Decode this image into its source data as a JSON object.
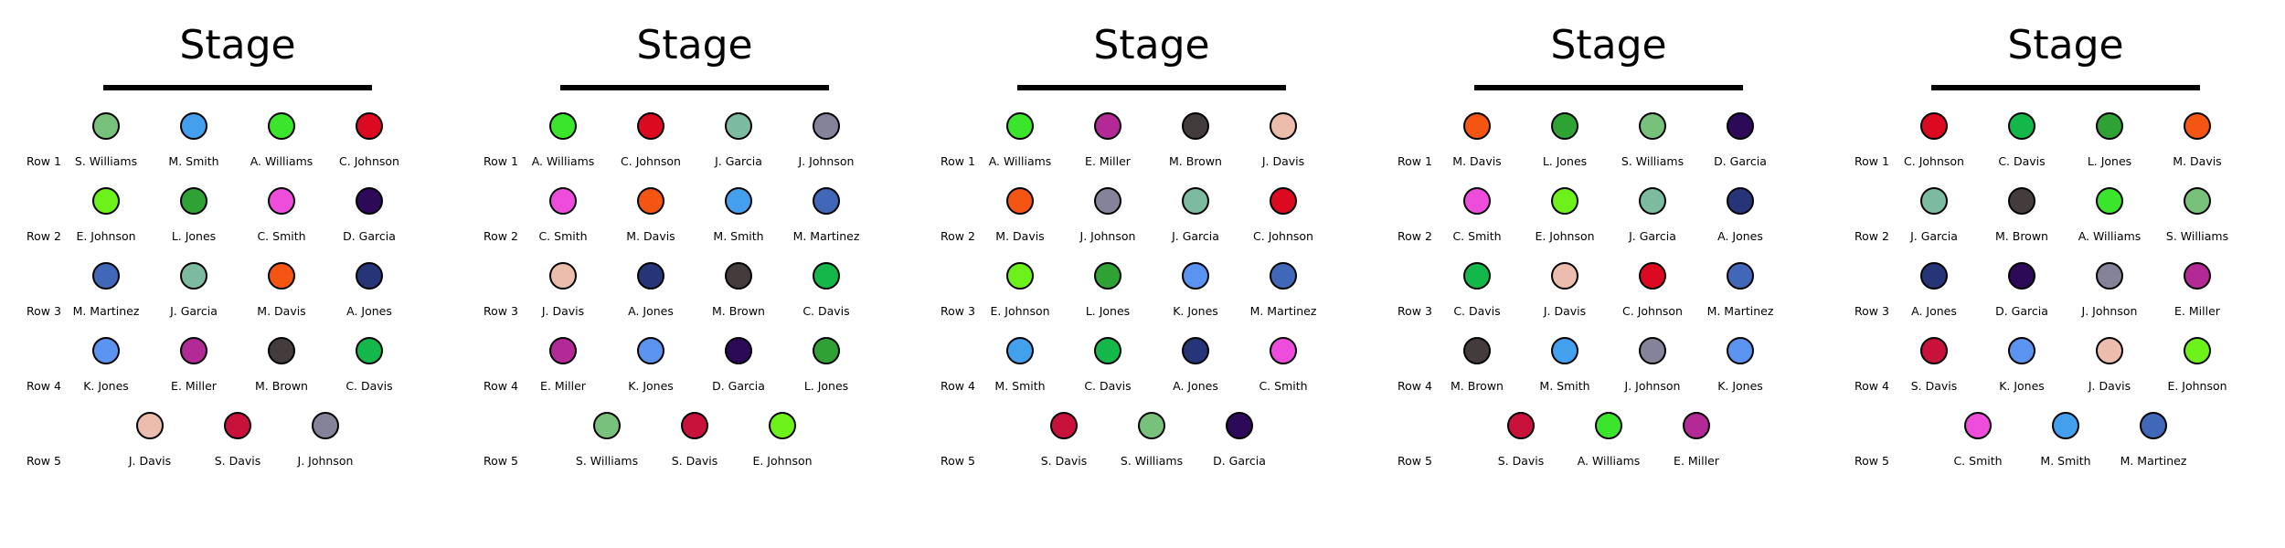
{
  "stage_label": "Stage",
  "panels": [
    {
      "rows": [
        {
          "label": "Row 1",
          "seats": [
            {
              "name": "S. Williams",
              "color": "#78c17b"
            },
            {
              "name": "M. Smith",
              "color": "#42a0ee"
            },
            {
              "name": "A. Williams",
              "color": "#3ae52c"
            },
            {
              "name": "C. Johnson",
              "color": "#dc0a20"
            }
          ]
        },
        {
          "label": "Row 2",
          "seats": [
            {
              "name": "E. Johnson",
              "color": "#6cf21a"
            },
            {
              "name": "L. Jones",
              "color": "#2fa235"
            },
            {
              "name": "C. Smith",
              "color": "#ee4ddb"
            },
            {
              "name": "D. Garcia",
              "color": "#2c0a58"
            }
          ]
        },
        {
          "label": "Row 3",
          "seats": [
            {
              "name": "M. Martinez",
              "color": "#4168b8"
            },
            {
              "name": "J. Garcia",
              "color": "#7dbba0"
            },
            {
              "name": "M. Davis",
              "color": "#f45512"
            },
            {
              "name": "A. Jones",
              "color": "#263478"
            }
          ]
        },
        {
          "label": "Row 4",
          "seats": [
            {
              "name": "K. Jones",
              "color": "#5b94f0"
            },
            {
              "name": "E. Miller",
              "color": "#b32996"
            },
            {
              "name": "M. Brown",
              "color": "#443c3c"
            },
            {
              "name": "C. Davis",
              "color": "#14b84a"
            }
          ]
        },
        {
          "label": "Row 5",
          "seats": [
            {
              "name": "J. Davis",
              "color": "#ecbcac"
            },
            {
              "name": "S. Davis",
              "color": "#c8123c"
            },
            {
              "name": "J. Johnson",
              "color": "#85839a"
            }
          ]
        }
      ]
    },
    {
      "rows": [
        {
          "label": "Row 1",
          "seats": [
            {
              "name": "A. Williams",
              "color": "#3ae52c"
            },
            {
              "name": "C. Johnson",
              "color": "#dc0a20"
            },
            {
              "name": "J. Garcia",
              "color": "#7dbba0"
            },
            {
              "name": "J. Johnson",
              "color": "#85839a"
            }
          ]
        },
        {
          "label": "Row 2",
          "seats": [
            {
              "name": "C. Smith",
              "color": "#ee4ddb"
            },
            {
              "name": "M. Davis",
              "color": "#f45512"
            },
            {
              "name": "M. Smith",
              "color": "#42a0ee"
            },
            {
              "name": "M. Martinez",
              "color": "#4168b8"
            }
          ]
        },
        {
          "label": "Row 3",
          "seats": [
            {
              "name": "J. Davis",
              "color": "#ecbcac"
            },
            {
              "name": "A. Jones",
              "color": "#263478"
            },
            {
              "name": "M. Brown",
              "color": "#443c3c"
            },
            {
              "name": "C. Davis",
              "color": "#14b84a"
            }
          ]
        },
        {
          "label": "Row 4",
          "seats": [
            {
              "name": "E. Miller",
              "color": "#b32996"
            },
            {
              "name": "K. Jones",
              "color": "#5b94f0"
            },
            {
              "name": "D. Garcia",
              "color": "#2c0a58"
            },
            {
              "name": "L. Jones",
              "color": "#2fa235"
            }
          ]
        },
        {
          "label": "Row 5",
          "seats": [
            {
              "name": "S. Williams",
              "color": "#78c17b"
            },
            {
              "name": "S. Davis",
              "color": "#c8123c"
            },
            {
              "name": "E. Johnson",
              "color": "#6cf21a"
            }
          ]
        }
      ]
    },
    {
      "rows": [
        {
          "label": "Row 1",
          "seats": [
            {
              "name": "A. Williams",
              "color": "#3ae52c"
            },
            {
              "name": "E. Miller",
              "color": "#b32996"
            },
            {
              "name": "M. Brown",
              "color": "#443c3c"
            },
            {
              "name": "J. Davis",
              "color": "#ecbcac"
            }
          ]
        },
        {
          "label": "Row 2",
          "seats": [
            {
              "name": "M. Davis",
              "color": "#f45512"
            },
            {
              "name": "J. Johnson",
              "color": "#85839a"
            },
            {
              "name": "J. Garcia",
              "color": "#7dbba0"
            },
            {
              "name": "C. Johnson",
              "color": "#dc0a20"
            }
          ]
        },
        {
          "label": "Row 3",
          "seats": [
            {
              "name": "E. Johnson",
              "color": "#6cf21a"
            },
            {
              "name": "L. Jones",
              "color": "#2fa235"
            },
            {
              "name": "K. Jones",
              "color": "#5b94f0"
            },
            {
              "name": "M. Martinez",
              "color": "#4168b8"
            }
          ]
        },
        {
          "label": "Row 4",
          "seats": [
            {
              "name": "M. Smith",
              "color": "#42a0ee"
            },
            {
              "name": "C. Davis",
              "color": "#14b84a"
            },
            {
              "name": "A. Jones",
              "color": "#263478"
            },
            {
              "name": "C. Smith",
              "color": "#ee4ddb"
            }
          ]
        },
        {
          "label": "Row 5",
          "seats": [
            {
              "name": "S. Davis",
              "color": "#c8123c"
            },
            {
              "name": "S. Williams",
              "color": "#78c17b"
            },
            {
              "name": "D. Garcia",
              "color": "#2c0a58"
            }
          ]
        }
      ]
    },
    {
      "rows": [
        {
          "label": "Row 1",
          "seats": [
            {
              "name": "M. Davis",
              "color": "#f45512"
            },
            {
              "name": "L. Jones",
              "color": "#2fa235"
            },
            {
              "name": "S. Williams",
              "color": "#78c17b"
            },
            {
              "name": "D. Garcia",
              "color": "#2c0a58"
            }
          ]
        },
        {
          "label": "Row 2",
          "seats": [
            {
              "name": "C. Smith",
              "color": "#ee4ddb"
            },
            {
              "name": "E. Johnson",
              "color": "#6cf21a"
            },
            {
              "name": "J. Garcia",
              "color": "#7dbba0"
            },
            {
              "name": "A. Jones",
              "color": "#263478"
            }
          ]
        },
        {
          "label": "Row 3",
          "seats": [
            {
              "name": "C. Davis",
              "color": "#14b84a"
            },
            {
              "name": "J. Davis",
              "color": "#ecbcac"
            },
            {
              "name": "C. Johnson",
              "color": "#dc0a20"
            },
            {
              "name": "M. Martinez",
              "color": "#4168b8"
            }
          ]
        },
        {
          "label": "Row 4",
          "seats": [
            {
              "name": "M. Brown",
              "color": "#443c3c"
            },
            {
              "name": "M. Smith",
              "color": "#42a0ee"
            },
            {
              "name": "J. Johnson",
              "color": "#85839a"
            },
            {
              "name": "K. Jones",
              "color": "#5b94f0"
            }
          ]
        },
        {
          "label": "Row 5",
          "seats": [
            {
              "name": "S. Davis",
              "color": "#c8123c"
            },
            {
              "name": "A. Williams",
              "color": "#3ae52c"
            },
            {
              "name": "E. Miller",
              "color": "#b32996"
            }
          ]
        }
      ]
    },
    {
      "rows": [
        {
          "label": "Row 1",
          "seats": [
            {
              "name": "C. Johnson",
              "color": "#dc0a20"
            },
            {
              "name": "C. Davis",
              "color": "#14b84a"
            },
            {
              "name": "L. Jones",
              "color": "#2fa235"
            },
            {
              "name": "M. Davis",
              "color": "#f45512"
            }
          ]
        },
        {
          "label": "Row 2",
          "seats": [
            {
              "name": "J. Garcia",
              "color": "#7dbba0"
            },
            {
              "name": "M. Brown",
              "color": "#443c3c"
            },
            {
              "name": "A. Williams",
              "color": "#3ae52c"
            },
            {
              "name": "S. Williams",
              "color": "#78c17b"
            }
          ]
        },
        {
          "label": "Row 3",
          "seats": [
            {
              "name": "A. Jones",
              "color": "#263478"
            },
            {
              "name": "D. Garcia",
              "color": "#2c0a58"
            },
            {
              "name": "J. Johnson",
              "color": "#85839a"
            },
            {
              "name": "E. Miller",
              "color": "#b32996"
            }
          ]
        },
        {
          "label": "Row 4",
          "seats": [
            {
              "name": "S. Davis",
              "color": "#c8123c"
            },
            {
              "name": "K. Jones",
              "color": "#5b94f0"
            },
            {
              "name": "J. Davis",
              "color": "#ecbcac"
            },
            {
              "name": "E. Johnson",
              "color": "#6cf21a"
            }
          ]
        },
        {
          "label": "Row 5",
          "seats": [
            {
              "name": "C. Smith",
              "color": "#ee4ddb"
            },
            {
              "name": "M. Smith",
              "color": "#42a0ee"
            },
            {
              "name": "M. Martinez",
              "color": "#4168b8"
            }
          ]
        }
      ]
    }
  ]
}
